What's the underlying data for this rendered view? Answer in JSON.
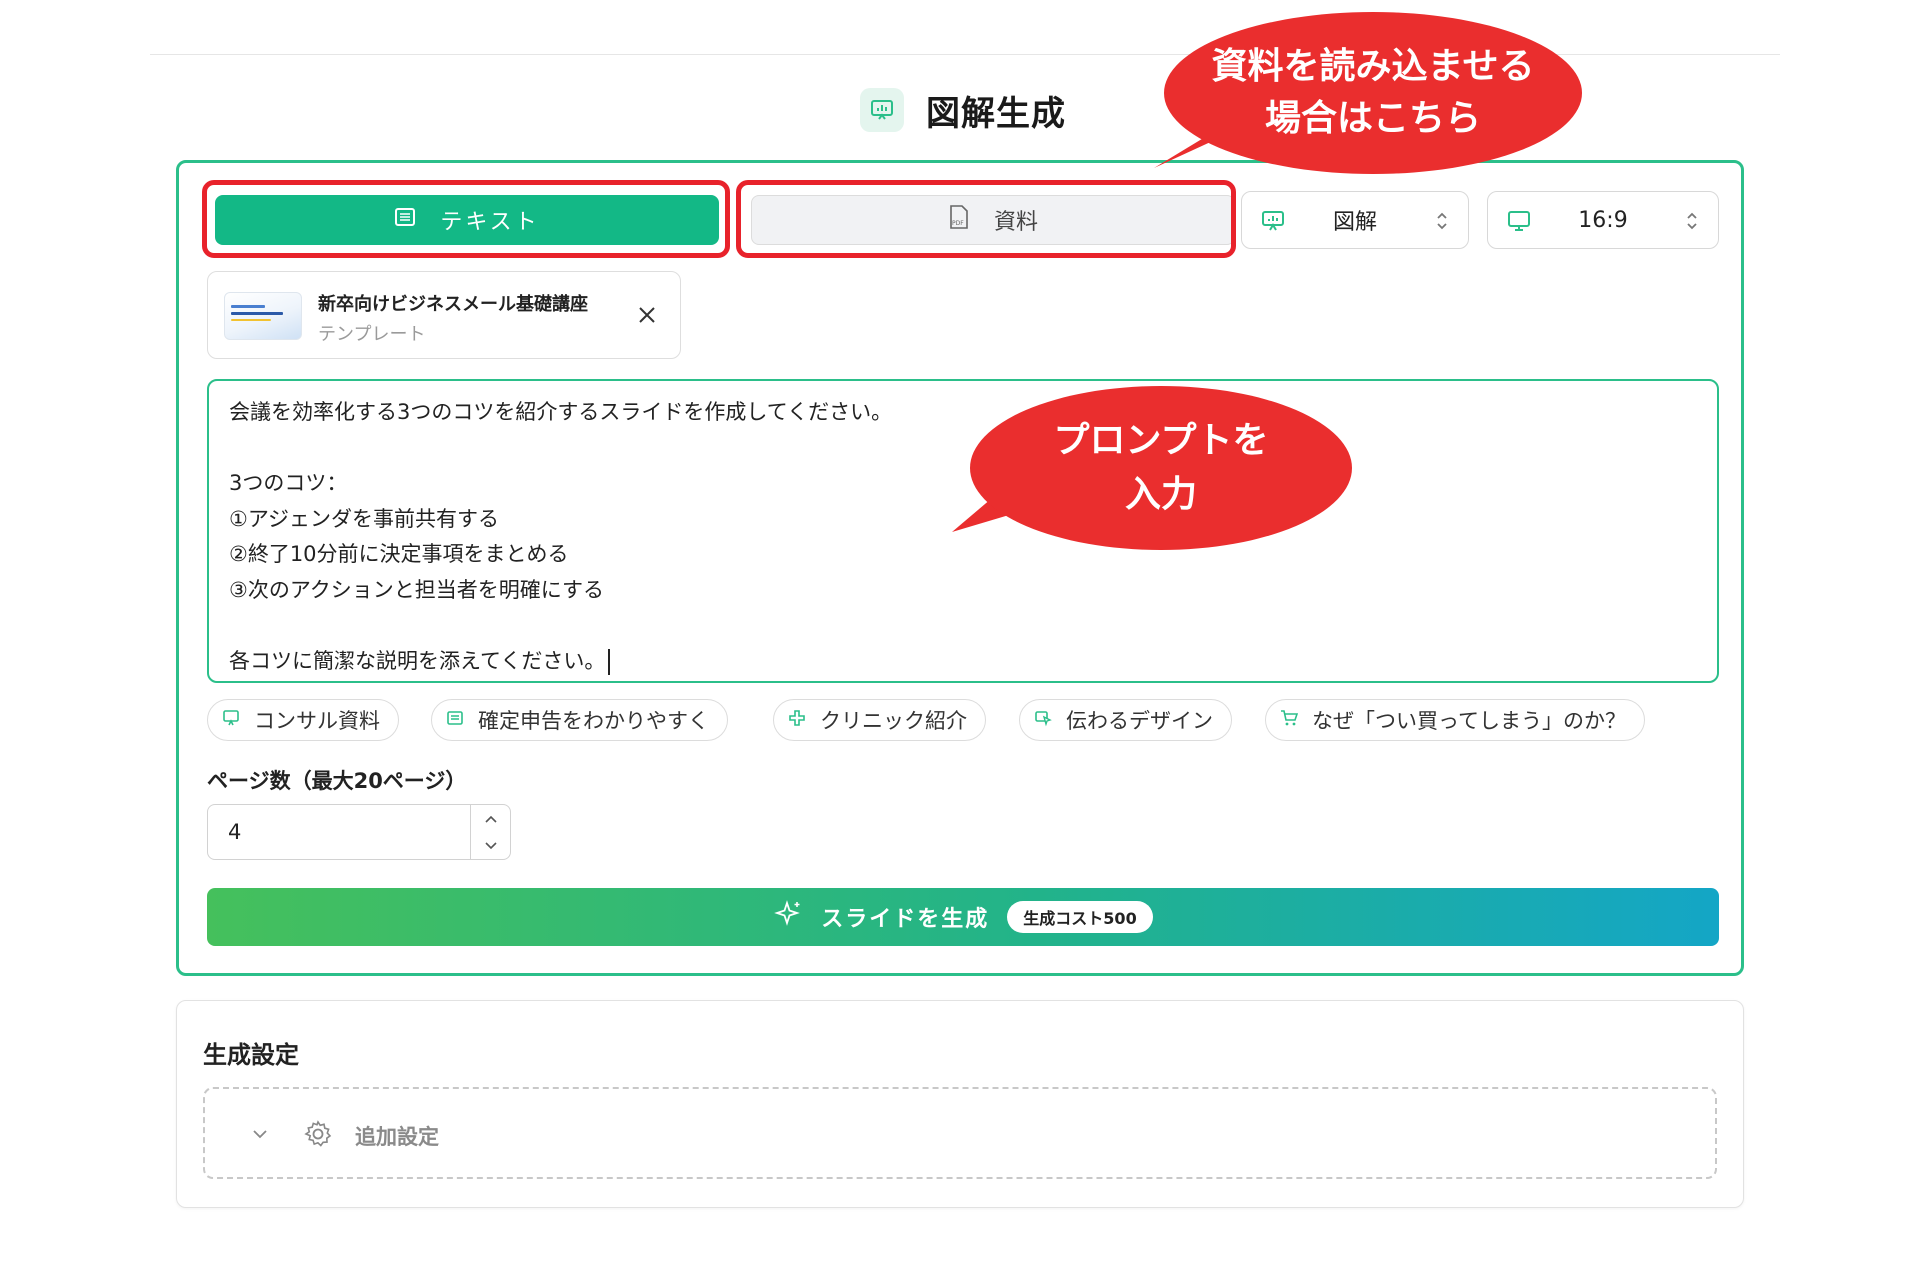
{
  "header": {
    "title": "図解生成",
    "title_icon": "presentation-chart-icon"
  },
  "mode_tabs": {
    "text_label": "テキスト",
    "text_icon": "text-icon",
    "doc_label": "資料",
    "doc_icon": "pdf-file-icon",
    "active": "text"
  },
  "selects": {
    "type": {
      "icon": "presentation-icon",
      "value": "図解"
    },
    "ratio": {
      "icon": "monitor-icon",
      "value": "16:9"
    }
  },
  "template": {
    "title": "新卒向けビジネスメール基礎講座",
    "subtitle": "テンプレート"
  },
  "prompt": {
    "lines": [
      "会議を効率化する3つのコツを紹介するスライドを作成してください。",
      "",
      "3つのコツ：",
      "①アジェンダを事前共有する",
      "②終了10分前に決定事項をまとめる",
      "③次のアクションと担当者を明確にする",
      "",
      "各コツに簡潔な説明を添えてください。"
    ]
  },
  "suggestions": [
    {
      "label": "コンサル資料",
      "icon": "presentation-icon"
    },
    {
      "label": "確定申告をわかりやすく",
      "icon": "document-icon"
    },
    {
      "label": "クリニック紹介",
      "icon": "medical-cross-icon"
    },
    {
      "label": "伝わるデザイン",
      "icon": "pointer-icon"
    },
    {
      "label": "なぜ「つい買ってしまう」のか？",
      "icon": "cart-icon"
    }
  ],
  "pages": {
    "label": "ページ数（最大20ページ）",
    "value": "4"
  },
  "generate": {
    "label": "スライドを生成",
    "cost_badge": "生成コスト500"
  },
  "settings": {
    "title": "生成設定",
    "advanced_label": "追加設定"
  },
  "annotations": {
    "doc_callout_line1": "資料を読み込ませる",
    "doc_callout_line2": "場合はこちら",
    "prompt_callout_line1": "プロンプトを",
    "prompt_callout_line2": "入力"
  },
  "colors": {
    "accent": "#13b886",
    "border_accent": "#2bbf8a",
    "callout_red": "#ea2e2e",
    "highlight_red": "#e8222b"
  }
}
